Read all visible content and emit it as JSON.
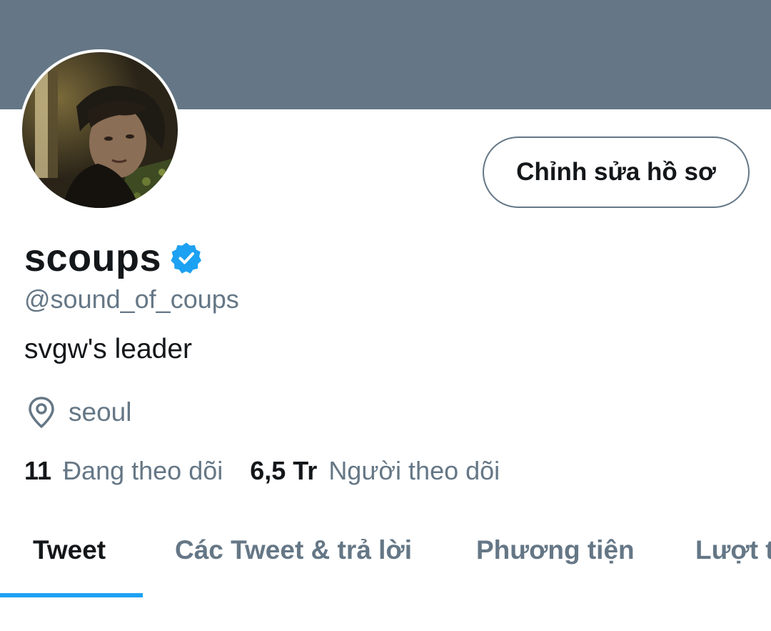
{
  "colors": {
    "banner": "#657786",
    "accent": "#1da1f2",
    "text_primary": "#14171a",
    "text_secondary": "#657786"
  },
  "profile": {
    "edit_button_label": "Chỉnh sửa hồ sơ",
    "display_name": "scoups",
    "verified": true,
    "handle": "@sound_of_coups",
    "bio": "svgw's leader",
    "location": "seoul",
    "location_icon": "location-pin-icon",
    "verified_icon": "verified-badge-icon"
  },
  "stats": {
    "following_count": "11",
    "following_label": "Đang theo dõi",
    "followers_count": "6,5 Tr",
    "followers_label": "Người theo dõi"
  },
  "tabs": [
    {
      "label": "Tweet",
      "active": true
    },
    {
      "label": "Các Tweet & trả lời",
      "active": false
    },
    {
      "label": "Phương tiện",
      "active": false
    },
    {
      "label": "Lượt thích",
      "active": false
    }
  ]
}
